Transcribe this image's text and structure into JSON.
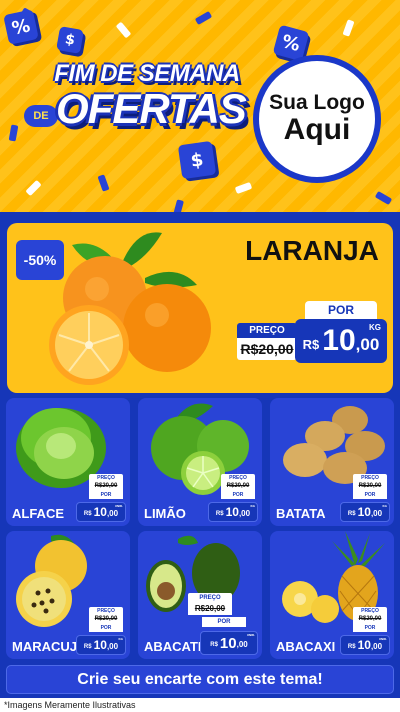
{
  "header": {
    "headline_top": "FIM DE SEMANA",
    "headline_connector": "DE",
    "headline_main": "OFERTAS",
    "logo_line1": "Sua Logo",
    "logo_line2": "Aqui",
    "cube_glyphs": [
      "%",
      "$",
      "%",
      "$"
    ]
  },
  "featured": {
    "discount": "-50%",
    "name": "LARANJA",
    "por_label": "POR",
    "preco_label": "PREÇO",
    "old_price": "R$20,00",
    "currency": "R$",
    "price_int": "10",
    "price_dec": ",00",
    "unit": "KG"
  },
  "products": [
    {
      "name": "ALFACE",
      "old_label": "PREÇO",
      "old_price": "R$20,00",
      "por_label": "POR",
      "currency": "R$",
      "price_int": "10",
      "price_dec": ",00",
      "unit": "UNID."
    },
    {
      "name": "LIMÃO",
      "old_label": "PREÇO",
      "old_price": "R$20,00",
      "por_label": "POR",
      "currency": "R$",
      "price_int": "10",
      "price_dec": ",00",
      "unit": "KG"
    },
    {
      "name": "BATATA",
      "old_label": "PREÇO",
      "old_price": "R$20,00",
      "por_label": "POR",
      "currency": "R$",
      "price_int": "10",
      "price_dec": ",00",
      "unit": "KG"
    },
    {
      "name": "MARACUJÁ",
      "old_label": "PREÇO",
      "old_price": "R$20,00",
      "por_label": "POR",
      "currency": "R$",
      "price_int": "10",
      "price_dec": ",00",
      "unit": "KG"
    },
    {
      "name": "ABACATE",
      "old_label": "PREÇO",
      "old_price": "R$20,00",
      "por_label": "POR",
      "currency": "R$",
      "price_int": "10",
      "price_dec": ",00",
      "unit": "UNID."
    },
    {
      "name": "ABACAXI",
      "old_label": "PREÇO",
      "old_price": "R$20,00",
      "por_label": "POR",
      "currency": "R$",
      "price_int": "10",
      "price_dec": ",00",
      "unit": "UNID."
    }
  ],
  "footer": {
    "cta": "Crie seu encarte com este tema!",
    "disclaimer": "*Imagens Meramente Ilustrativas"
  },
  "colors": {
    "primary_blue": "#1636b8",
    "card_blue": "#2944d6",
    "accent_yellow": "#ffc21a"
  }
}
